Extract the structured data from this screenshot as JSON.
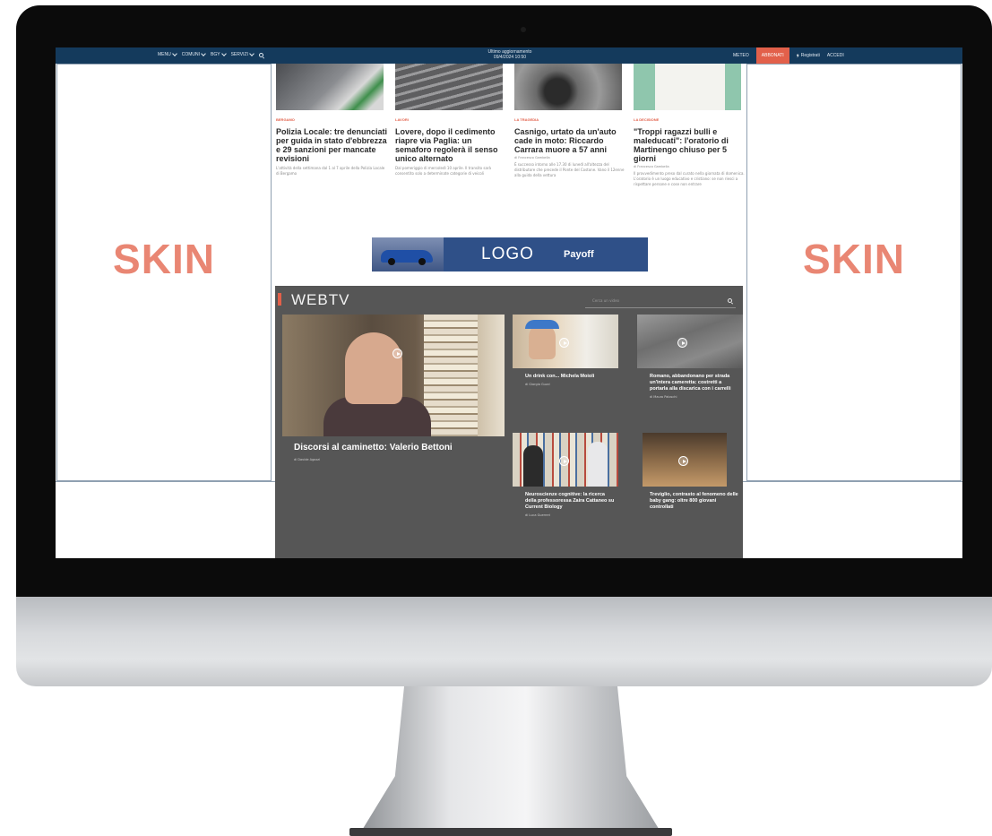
{
  "nav": {
    "items": [
      "MENU",
      "COMUNI",
      "BGY",
      "SERVIZI"
    ],
    "update_label": "Ultimo aggiornamento",
    "update_time": "09/4/2024 10:50",
    "meteo": "METEO",
    "abbonati": "ABBONATI",
    "registrati": "Registrati",
    "accedi": "ACCEDI"
  },
  "skin": {
    "left_label": "SKIN",
    "right_label": "SKIN"
  },
  "articles": [
    {
      "kicker": "BERGAMO",
      "headline": "Polizia Locale: tre denunciati per guida in stato d'ebbrezza e 29 sanzioni per mancate revisioni",
      "summary": "L'attività della settimana dal 1 al 7 aprile della Polizia Locale di Bergamo"
    },
    {
      "kicker": "LAVORI",
      "headline": "Lovere, dopo il cedimento riapre via Paglia: un semaforo regolerà il senso unico alternato",
      "summary": "Dal pomeriggio di mercoledì 10 aprile. Il transito sarà consentito solo a determinate categorie di veicoli"
    },
    {
      "kicker": "LA TRAGEDIA",
      "headline": "Casnigo, urtato da un'auto cade in moto: Riccardo Carrara muore a 57 anni",
      "byline": "di Francesco Gambella",
      "summary": "È successo intorno alle 17.30 di lunedì all'altezza del distributore che precede il Ponte del Costone. Vano il 12enne alla guida della vettura"
    },
    {
      "kicker": "LA DECISIONE",
      "headline": "\"Troppi ragazzi bulli e maleducati\": l'oratorio di Martinengo chiuso per 5 giorni",
      "byline": "di Francesco Gambella",
      "summary": "Il provvedimento preso dal curato nella giornata di domenica. L'oratorio è un luogo educativo e cristiano: se non riesci a rispettare persone e cose non entrare"
    }
  ],
  "banner": {
    "logo": "LOGO",
    "payoff": "Payoff"
  },
  "webtv": {
    "title": "WEBTV",
    "search_placeholder": "Cerca un video",
    "main": {
      "title": "Discorsi al caminetto: Valerio Bettoni",
      "byline": "di Davide Agazzi"
    },
    "videos": [
      {
        "title": "Un drink con... Michela Moioli",
        "byline": "di Giorgio Guzzi"
      },
      {
        "title": "Romano, abbandonano per strada un'intera cameretta: costretti a portarla alla discarica con i carrelli",
        "byline": "di Mauro Paloschi"
      },
      {
        "title": "Neuroscienze cognitive: la ricerca della professoressa Zaira Cattaneo su Current Biology",
        "byline": "di Luca Guerreri"
      },
      {
        "title": "Treviglio, contrasto al fenomeno delle baby gang: oltre 800 giovani controllati",
        "byline": ""
      }
    ]
  },
  "colors": {
    "nav_bg": "#143a5c",
    "accent": "#e2604a",
    "skin_text": "#e98673",
    "webtv_bg": "#565656"
  }
}
